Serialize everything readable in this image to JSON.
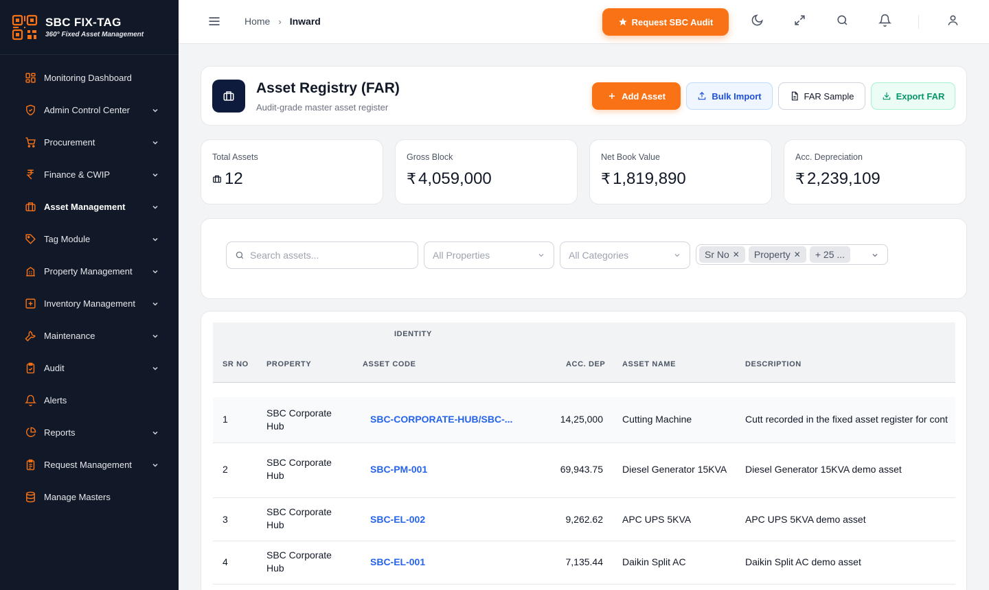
{
  "brand": {
    "title": "SBC FIX-TAG",
    "subtitle": "360° Fixed Asset Management"
  },
  "sidebar": {
    "items": [
      {
        "label": "Monitoring Dashboard",
        "icon": "dashboard-icon",
        "has_submenu": false
      },
      {
        "label": "Admin Control Center",
        "icon": "shield-icon",
        "has_submenu": true
      },
      {
        "label": "Procurement",
        "icon": "cart-icon",
        "has_submenu": true
      },
      {
        "label": "Finance & CWIP",
        "icon": "rupee-icon",
        "has_submenu": true
      },
      {
        "label": "Asset Management",
        "icon": "briefcase-icon",
        "has_submenu": true,
        "active": true
      },
      {
        "label": "Tag Module",
        "icon": "tag-icon",
        "has_submenu": true
      },
      {
        "label": "Property Management",
        "icon": "building-icon",
        "has_submenu": true
      },
      {
        "label": "Inventory Management",
        "icon": "plus-box-icon",
        "has_submenu": true
      },
      {
        "label": "Maintenance",
        "icon": "wrench-icon",
        "has_submenu": true
      },
      {
        "label": "Audit",
        "icon": "clipboard-check-icon",
        "has_submenu": true
      },
      {
        "label": "Alerts",
        "icon": "bell-icon",
        "has_submenu": false
      },
      {
        "label": "Reports",
        "icon": "pie-chart-icon",
        "has_submenu": true
      },
      {
        "label": "Request Management",
        "icon": "clipboard-list-icon",
        "has_submenu": true
      },
      {
        "label": "Manage Masters",
        "icon": "database-icon",
        "has_submenu": false
      }
    ]
  },
  "breadcrumb": {
    "home": "Home",
    "separator": "›",
    "current": "Inward"
  },
  "topbar": {
    "audit_button": "Request SBC Audit"
  },
  "registry": {
    "title": "Asset Registry (FAR)",
    "subtitle": "Audit-grade master asset register",
    "actions": {
      "add": "Add Asset",
      "bulk": "Bulk Import",
      "sample": "FAR Sample",
      "export": "Export FAR"
    }
  },
  "stats": [
    {
      "label": "Total Assets",
      "prefix": "",
      "value": "12"
    },
    {
      "label": "Gross Block",
      "prefix": "₹",
      "value": "4,059,000"
    },
    {
      "label": "Net Book Value",
      "prefix": "₹",
      "value": "1,819,890"
    },
    {
      "label": "Acc. Depreciation",
      "prefix": "₹",
      "value": "2,239,109"
    }
  ],
  "filters": {
    "search_placeholder": "Search assets...",
    "property": "All Properties",
    "category": "All Categories",
    "column_chips": [
      "Sr No",
      "Property"
    ],
    "more_chip": "+ 25 ..."
  },
  "table": {
    "group_header": "IDENTITY",
    "columns": [
      "SR NO",
      "PROPERTY",
      "ASSET CODE",
      "ACC. DEP",
      "ASSET NAME",
      "DESCRIPTION"
    ],
    "rows": [
      {
        "sr": "1",
        "property": "SBC Corporate Hub",
        "code": "SBC-CORPORATE-HUB/SBC-...",
        "acc_dep": "14,25,000",
        "name": "Cutting Machine",
        "desc": "Cutt recorded in the fixed asset register for cont"
      },
      {
        "sr": "2",
        "property": "SBC Corporate Hub",
        "code": "SBC-PM-001",
        "acc_dep": "69,943.75",
        "name": "Diesel Generator 15KVA",
        "desc": "Diesel Generator 15KVA demo asset"
      },
      {
        "sr": "3",
        "property": "SBC Corporate Hub",
        "code": "SBC-EL-002",
        "acc_dep": "9,262.62",
        "name": "APC UPS 5KVA",
        "desc": "APC UPS 5KVA demo asset"
      },
      {
        "sr": "4",
        "property": "SBC Corporate Hub",
        "code": "SBC-EL-001",
        "acc_dep": "7,135.44",
        "name": "Daikin Split AC",
        "desc": "Daikin Split AC demo asset"
      }
    ]
  },
  "colors": {
    "accent": "#f97316",
    "sidebar_bg": "#111827",
    "link": "#2563eb",
    "export": "#059669"
  }
}
